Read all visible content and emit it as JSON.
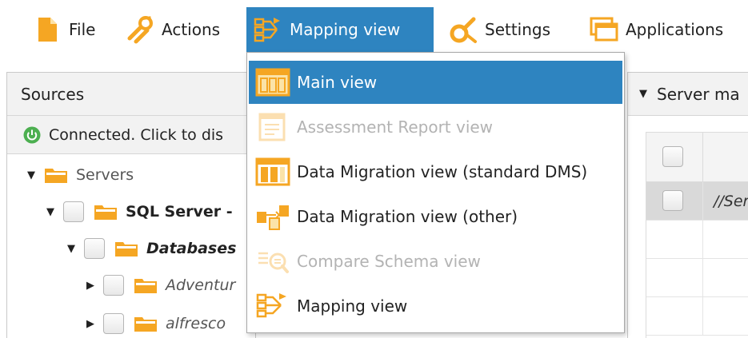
{
  "menubar": {
    "file": "File",
    "actions": "Actions",
    "mapping_view": "Mapping view",
    "settings": "Settings",
    "applications": "Applications"
  },
  "sources": {
    "title": "Sources",
    "status": "Connected. Click to dis",
    "tree": [
      {
        "label": "Servers",
        "style": "plain",
        "expanded": true,
        "checkbox": false
      },
      {
        "label": "SQL Server -",
        "style": "bold",
        "expanded": true,
        "checkbox": true
      },
      {
        "label": "Databases",
        "style": "bold-italic",
        "expanded": true,
        "checkbox": true
      },
      {
        "label": "Adventur",
        "style": "italic",
        "expanded": false,
        "checkbox": true
      },
      {
        "label": "alfresco",
        "style": "italic",
        "expanded": false,
        "checkbox": true
      }
    ]
  },
  "server_panel": {
    "title": "Server ma",
    "rows": [
      "//Ser"
    ]
  },
  "mapping_menu": {
    "items": [
      {
        "label": "Main view",
        "state": "highlighted"
      },
      {
        "label": "Assessment Report view",
        "state": "disabled"
      },
      {
        "label": "Data Migration view (standard DMS)",
        "state": "enabled"
      },
      {
        "label": "Data Migration view (other)",
        "state": "enabled"
      },
      {
        "label": "Compare Schema view",
        "state": "disabled"
      },
      {
        "label": "Mapping view",
        "state": "enabled"
      }
    ]
  },
  "colors": {
    "accent": "#2e84c0",
    "icon_orange": "#f5a623",
    "connected_green": "#4caf50"
  }
}
